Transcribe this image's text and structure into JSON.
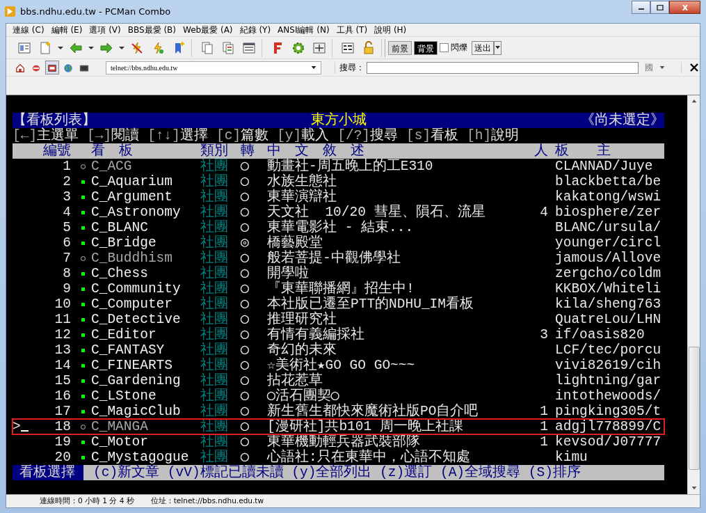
{
  "window": {
    "title": "bbs.ndhu.edu.tw - PCMan Combo"
  },
  "menu": [
    "連線 (C)",
    "編輯 (E)",
    "選項 (V)",
    "BBS最愛 (B)",
    "Web最愛 (A)",
    "紀錄 (Y)",
    "ANSI編輯 (N)",
    "工具 (T)",
    "說明 (H)"
  ],
  "color_bar": {
    "foreground": {
      "label": "前景",
      "selected": false
    },
    "background": {
      "label": "背景",
      "selected": true
    },
    "blink": {
      "label": "閃爍",
      "checked": false
    },
    "send": "送出"
  },
  "address": {
    "value": "telnet://bbs.ndhu.edu.tw"
  },
  "search": {
    "label": "搜尋：",
    "lang": "國"
  },
  "terminal": {
    "title_bar": {
      "left": "【看板列表】",
      "center": "東方小城",
      "right": "《尚未選定》"
    },
    "help": [
      {
        "key": "[←]",
        "label": "主選單"
      },
      {
        "key": "[→]",
        "label": "閱讀"
      },
      {
        "key": "[↑↓]",
        "label": "選擇"
      },
      {
        "key": "[c]",
        "label": "篇數"
      },
      {
        "key": "[y]",
        "label": "載入"
      },
      {
        "key": "[/?]",
        "label": "搜尋"
      },
      {
        "key": "[s]",
        "label": "看板"
      },
      {
        "key": "[h]",
        "label": "說明"
      }
    ],
    "columns": [
      "編號",
      "看　板",
      "類別",
      "轉",
      "中　文　敘　述",
      "人",
      "板　　主"
    ],
    "rows": [
      {
        "number": "1",
        "unread": false,
        "board": "C_ACG",
        "category": "社團",
        "transfer": "◯",
        "description": "動畫社-周五晚上的工E310",
        "moderators": "CLANNAD/Juye",
        "selected": false
      },
      {
        "number": "2",
        "unread": true,
        "board": "C_Aquarium",
        "category": "社團",
        "transfer": "◯",
        "description": "水族生態社",
        "moderators": "blackbetta/be",
        "selected": false
      },
      {
        "number": "3",
        "unread": true,
        "board": "C_Argument",
        "category": "社團",
        "transfer": "◯",
        "description": "東華演辯社",
        "moderators": "kakatong/wswi",
        "selected": false
      },
      {
        "number": "4",
        "unread": true,
        "board": "C_Astronomy",
        "category": "社團",
        "transfer": "◯",
        "description": "天文社  10/20 彗星、隕石、流星",
        "people": "4",
        "moderators": "biosphere/zer",
        "selected": false
      },
      {
        "number": "5",
        "unread": true,
        "board": "C_BLANC",
        "category": "社團",
        "transfer": "◯",
        "description": "東華電影社 - 結束...",
        "moderators": "BLANC/ursula/",
        "selected": false
      },
      {
        "number": "6",
        "unread": true,
        "board": "C_Bridge",
        "category": "社團",
        "transfer": "◎",
        "description": "橋藝殿堂",
        "moderators": "younger/circl",
        "selected": false
      },
      {
        "number": "7",
        "unread": false,
        "board": "C_Buddhism",
        "category": "社團",
        "transfer": "◯",
        "description": "般若菩提-中觀佛學社",
        "moderators": "jamous/Allove",
        "selected": false
      },
      {
        "number": "8",
        "unread": true,
        "board": "C_Chess",
        "category": "社團",
        "transfer": "◯",
        "description": "開學啦",
        "moderators": "zergcho/coldm",
        "selected": false
      },
      {
        "number": "9",
        "unread": true,
        "board": "C_Community",
        "category": "社團",
        "transfer": "◯",
        "description": "『東華聯播網』招生中!",
        "moderators": "KKBOX/Whiteli",
        "selected": false
      },
      {
        "number": "10",
        "unread": true,
        "board": "C_Computer",
        "category": "社團",
        "transfer": "◯",
        "description": "本社版已遷至PTT的NDHU_IM看板",
        "moderators": "kila/sheng763",
        "selected": false
      },
      {
        "number": "11",
        "unread": true,
        "board": "C_Detective",
        "category": "社團",
        "transfer": "◯",
        "description": "推理研究社",
        "moderators": "QuatreLou/LHN",
        "selected": false
      },
      {
        "number": "12",
        "unread": true,
        "board": "C_Editor",
        "category": "社團",
        "transfer": "◯",
        "description": "有情有義編採社",
        "people": "3",
        "moderators": "if/oasis820",
        "selected": false
      },
      {
        "number": "13",
        "unread": true,
        "board": "C_FANTASY",
        "category": "社團",
        "transfer": "◯",
        "description": "奇幻的未來",
        "moderators": "LCF/tec/porcu",
        "selected": false
      },
      {
        "number": "14",
        "unread": true,
        "board": "C_FINEARTS",
        "category": "社團",
        "transfer": "◯",
        "description": "☆美術社★GO GO GO~~~",
        "moderators": "vivi82619/cih",
        "selected": false
      },
      {
        "number": "15",
        "unread": true,
        "board": "C_Gardening",
        "category": "社團",
        "transfer": "◯",
        "description": "拈花惹草",
        "moderators": "lightning/gar",
        "selected": false
      },
      {
        "number": "16",
        "unread": true,
        "board": "C_LStone",
        "category": "社團",
        "transfer": "◯",
        "description": "◯活石團契◯",
        "moderators": "intothewoods/",
        "selected": false
      },
      {
        "number": "17",
        "unread": true,
        "board": "C_MagicClub",
        "category": "社團",
        "transfer": "◯",
        "description": "新生舊生都快來魔術社版PO自介吧",
        "people": "1",
        "moderators": "pingking305/t",
        "selected": false
      },
      {
        "number": "18",
        "unread": false,
        "board": "C_MANGA",
        "category": "社團",
        "transfer": "◯",
        "description": "[漫研社]共b101 周一晚上社課",
        "people": "1",
        "moderators": "adgjl778899/C",
        "selected": true,
        "pointer": ">"
      },
      {
        "number": "19",
        "unread": true,
        "board": "C_Motor",
        "category": "社團",
        "transfer": "◯",
        "description": "東華機動輕兵器武裝部隊",
        "people": "1",
        "moderators": "kevsod/J07777",
        "selected": false
      },
      {
        "number": "20",
        "unread": true,
        "board": "C_Mystagogue",
        "category": "社團",
        "transfer": "◯",
        "description": "心語社:只在東華中，心語不知處",
        "moderators": "kimu",
        "selected": false
      }
    ],
    "footer": {
      "label": "看板選擇",
      "hints": "(c)新文章 (vV)標記已讀未讀 (y)全部列出 (z)選訂 (A)全域搜尋 (S)排序"
    }
  },
  "status_bar": {
    "connection": "連線時間：0 小時 1 分 4 秒",
    "address": "位址：telnet://bbs.ndhu.edu.tw"
  }
}
